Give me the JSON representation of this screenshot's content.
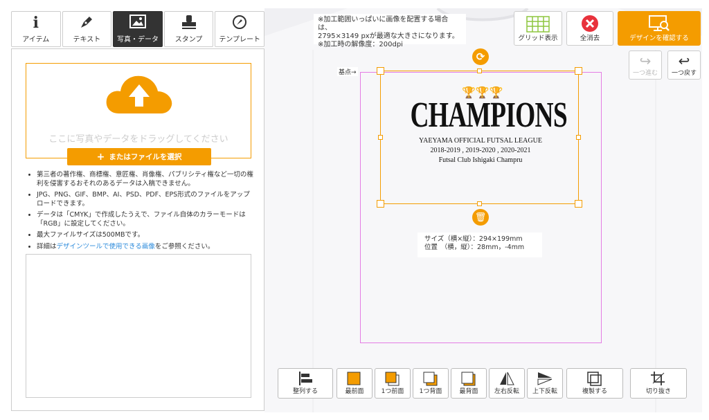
{
  "tabs": [
    {
      "label": "アイテム",
      "icon": "info-icon"
    },
    {
      "label": "テキスト",
      "icon": "pen-icon"
    },
    {
      "label": "写真・データ",
      "icon": "image-icon"
    },
    {
      "label": "スタンプ",
      "icon": "stamp-icon"
    },
    {
      "label": "テンプレート",
      "icon": "compass-icon"
    }
  ],
  "upload": {
    "drop_text": "ここに写真やデータをドラッグしてください",
    "select_label": "またはファイルを選択"
  },
  "notes": [
    "第三者の著作権、商標権、意匠権、肖像権、パブリシティ権など一切の権利を侵害するおそれのあるデータは入稿できません。",
    "JPG、PNG、GIF、BMP、AI、PSD、PDF、EPS形式のファイルをアップロードできます。",
    "データは「CMYK」で作成したうえで、ファイル自体のカラーモードは「RGB」に設定してください。",
    "最大ファイルサイズは500MBです。"
  ],
  "notes_link": {
    "prefix": "詳細は",
    "link": "デザインツールで使用できる画像",
    "suffix": "をご参照ください。"
  },
  "info_top": [
    "※加工範囲いっぱいに画像を配置する場合は、",
    "2795×3149 pxが最適な大きさになります。",
    "※加工時の解像度：200dpi"
  ],
  "top_buttons": {
    "grid": "グリッド表示",
    "clear": "全消去",
    "confirm": "デザインを確認する"
  },
  "nav": {
    "redo": "一つ進む",
    "undo": "一つ戻す"
  },
  "origin_label": "基点→",
  "design": {
    "title": "CHAMPIONS",
    "line1": "YAEYAMA OFFICIAL FUTSAL LEAGUE",
    "line2": "2018-2019 , 2019-2020 , 2020-2021",
    "line3": "Futsal Club Ishigaki Champru"
  },
  "size_info": {
    "size": "サイズ（横×縦）：294×199mm",
    "position": "位置　（横，縦）：28mm，-4mm"
  },
  "bottom_buttons": [
    "整列する",
    "最前面",
    "1つ前面",
    "1つ背面",
    "最背面",
    "左右反転",
    "上下反転",
    "複製する",
    "切り抜き"
  ],
  "colors": {
    "accent": "#f49c00",
    "danger": "#e8323c",
    "frame": "#e47ce4"
  }
}
